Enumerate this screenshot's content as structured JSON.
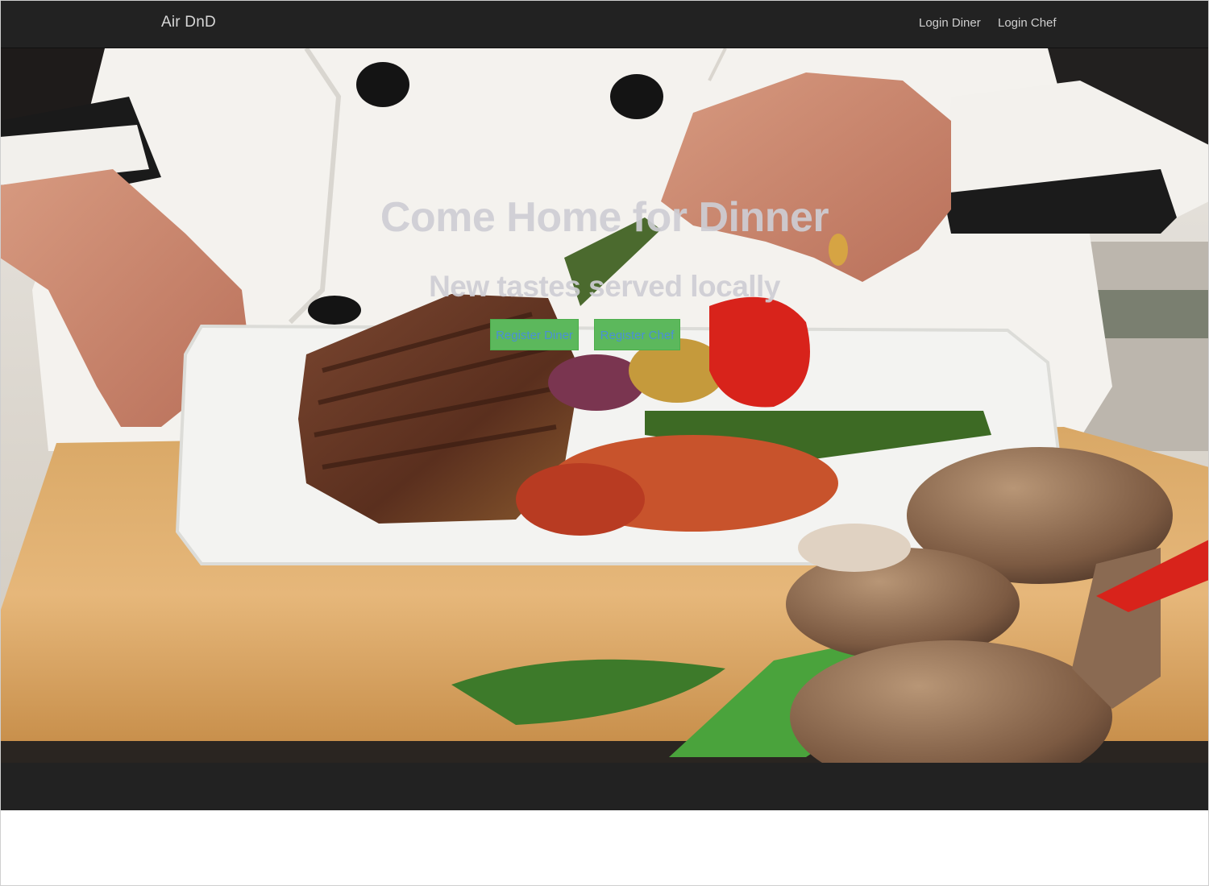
{
  "navbar": {
    "brand": "Air DnD",
    "links": [
      {
        "label": "Login Diner"
      },
      {
        "label": "Login Chef"
      }
    ]
  },
  "hero": {
    "title": "Come Home for Dinner",
    "subtitle": "New tastes served locally",
    "buttons": [
      {
        "label": "Register Diner"
      },
      {
        "label": "Register Chef"
      }
    ]
  },
  "colors": {
    "navbar_bg": "#222222",
    "button_bg": "#5cb85c",
    "button_text": "#4a8fd6",
    "hero_text": "#cdcdd4"
  }
}
